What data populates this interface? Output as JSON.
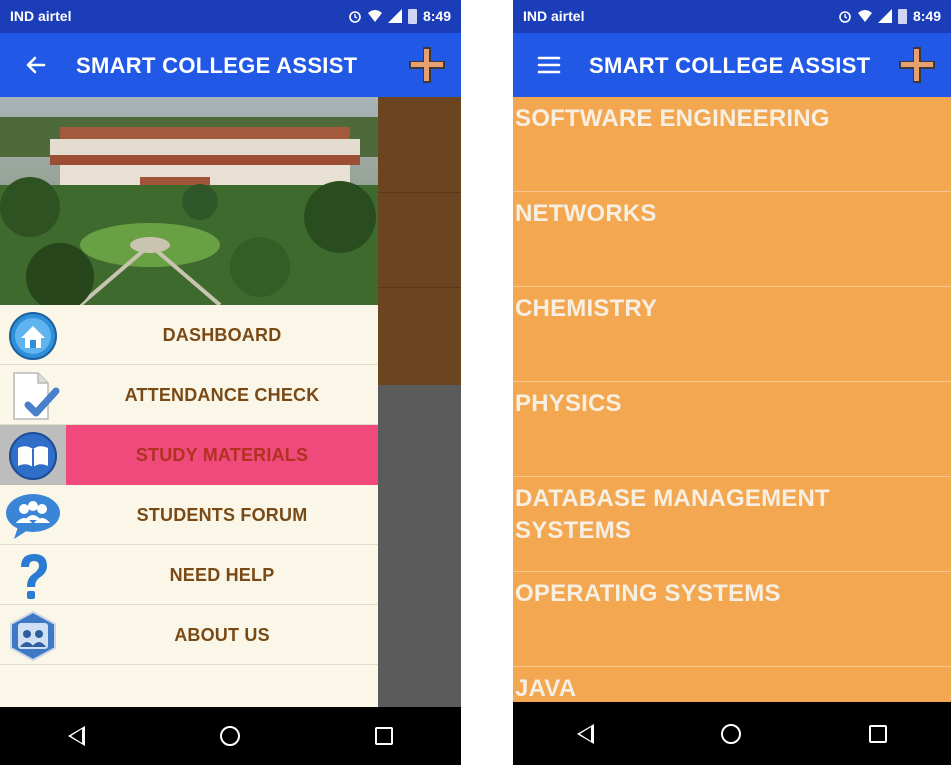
{
  "left_screen": {
    "status": {
      "carrier": "IND airtel",
      "time": "8:49"
    },
    "appbar": {
      "title": "SMART COLLEGE ASSIST",
      "nav_icon": "back-arrow-icon"
    },
    "menu": [
      {
        "label": "DASHBOARD",
        "icon": "home-icon",
        "active": false
      },
      {
        "label": "ATTENDANCE CHECK",
        "icon": "document-check-icon",
        "active": false
      },
      {
        "label": "STUDY MATERIALS",
        "icon": "book-icon",
        "active": true
      },
      {
        "label": "STUDENTS FORUM",
        "icon": "group-chat-icon",
        "active": false
      },
      {
        "label": "NEED HELP",
        "icon": "question-mark-icon",
        "active": false
      },
      {
        "label": "ABOUT US",
        "icon": "about-users-icon",
        "active": false
      }
    ]
  },
  "right_screen": {
    "status": {
      "carrier": "IND airtel",
      "time": "8:49"
    },
    "appbar": {
      "title": "SMART COLLEGE ASSIST",
      "nav_icon": "hamburger-menu-icon"
    },
    "subjects": [
      "SOFTWARE ENGINEERING",
      "NETWORKS",
      "CHEMISTRY",
      "PHYSICS",
      "DATABASE MANAGEMENT SYSTEMS",
      "OPERATING SYSTEMS",
      "JAVA"
    ]
  },
  "colors": {
    "status_bar": "#1c3db8",
    "app_bar": "#2158e6",
    "drawer_bg": "#faf7e8",
    "menu_text": "#7a4a16",
    "active_highlight": "#f04a7d",
    "subject_bg": "#f2a750",
    "subject_text": "#f7efe2"
  }
}
